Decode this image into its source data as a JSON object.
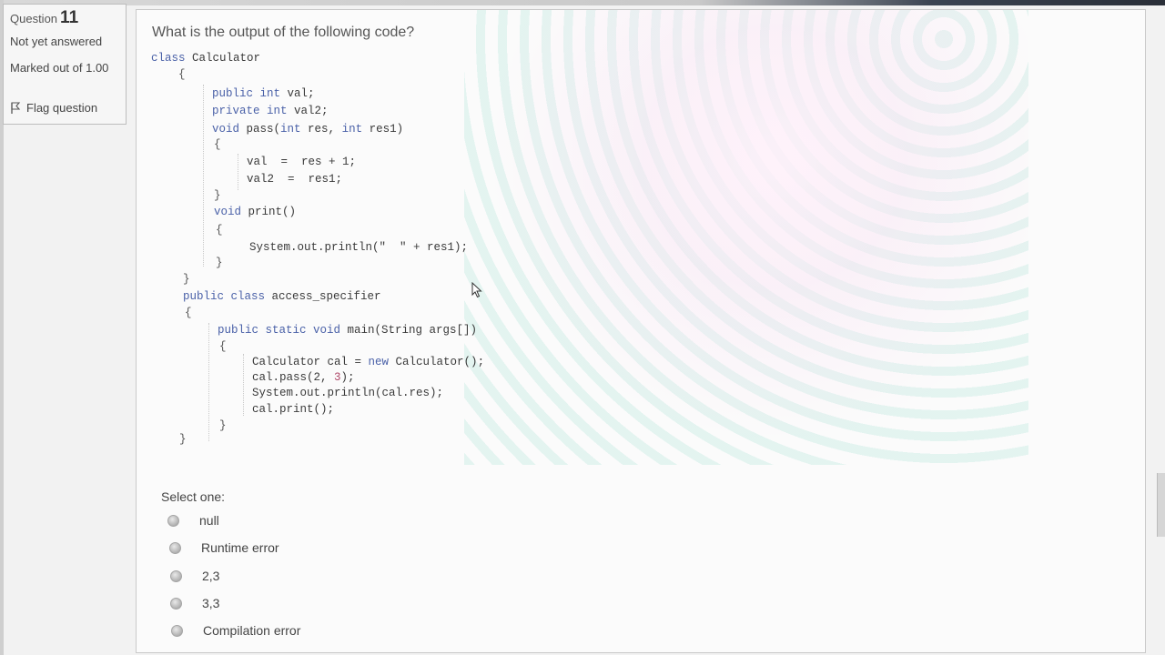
{
  "info": {
    "question_prefix": "Question",
    "question_number": "11",
    "state": "Not yet answered",
    "marked": "Marked out of 1.00",
    "flag_label": "Flag question"
  },
  "question": {
    "text": "What is the output of the following code?"
  },
  "code_lines": {
    "l1_kw": "class",
    "l1_rest": " Calculator",
    "l2_kw": "public int",
    "l2_rest": " val;",
    "l3_kw": "private int",
    "l3_rest": " val2;",
    "l4_kw": "void",
    "l4_a": " pass(",
    "l4_kw2": "int",
    "l4_b": " res, ",
    "l4_kw3": "int",
    "l4_c": " res1)",
    "l5": "val  =  res + 1;",
    "l6": "val2  =  res1;",
    "l7_kw": "void",
    "l7_rest": " print()",
    "l8": "System.out.println(\"  \" + res1);",
    "l9_kw": "public class",
    "l9_rest": " access_specifier",
    "l10_kw": "public static void",
    "l10_rest": " main(String args[])",
    "l11_a": "Calculator cal = ",
    "l11_kw": "new",
    "l11_b": " Calculator();",
    "l12_a": "cal.pass(2, ",
    "l12_num": "3",
    "l12_b": ");",
    "l13": "System.out.println(cal.res);",
    "l14": "cal.print();"
  },
  "select_label": "Select one:",
  "options": [
    "null",
    "Runtime error",
    "2,3",
    "3,3",
    "Compilation error"
  ]
}
